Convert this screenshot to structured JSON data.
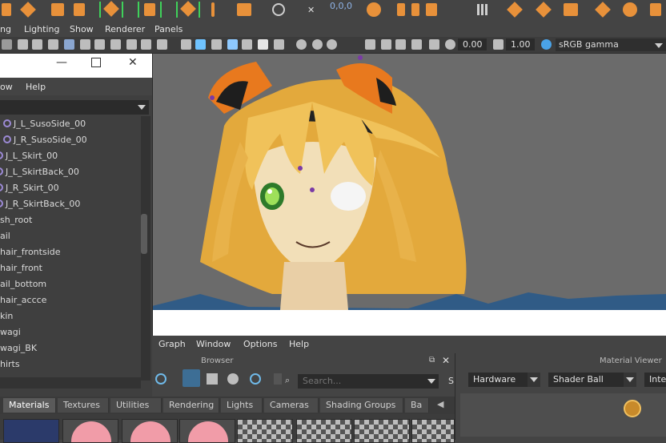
{
  "shelf": {
    "readout": "0,0,0",
    "icons": [
      "orange-shape-icon",
      "move-tool-icon",
      "scale-tool-icon",
      "rotate-tool-icon",
      "select-tool-icon",
      "snap-icon",
      "camera-icon"
    ]
  },
  "viewport_menu": {
    "items": [
      "ng",
      "Lighting",
      "Show",
      "Renderer",
      "Panels"
    ]
  },
  "viewport_toolbar": {
    "exposure": "0.00",
    "gamma": "1.00",
    "colorspace": "sRGB gamma"
  },
  "outliner": {
    "menu": [
      "ow",
      "Help"
    ],
    "items": [
      {
        "label": "J_L_SusoSide_00",
        "joint": true
      },
      {
        "label": "J_R_SusoSide_00",
        "joint": true
      },
      {
        "label": "J_L_Skirt_00",
        "joint": true
      },
      {
        "label": "J_L_SkirtBack_00",
        "joint": true
      },
      {
        "label": "J_R_Skirt_00",
        "joint": true
      },
      {
        "label": "J_R_SkirtBack_00",
        "joint": true
      },
      {
        "label": "sh_root",
        "joint": false
      },
      {
        "label": "ail",
        "joint": false
      },
      {
        "label": "hair_frontside",
        "joint": false
      },
      {
        "label": "hair_front",
        "joint": false
      },
      {
        "label": "ail_bottom",
        "joint": false
      },
      {
        "label": "hair_accce",
        "joint": false
      },
      {
        "label": "kin",
        "joint": false
      },
      {
        "label": "wagi",
        "joint": false
      },
      {
        "label": "wagi_BK",
        "joint": false
      },
      {
        "label": "hirts",
        "joint": false
      }
    ]
  },
  "hypershade": {
    "menu": [
      "Graph",
      "Window",
      "Options",
      "Help"
    ],
    "browser_label": "Browser",
    "search_placeholder": "Search...",
    "material_viewer_label": "Material Viewer",
    "renderer": "Hardware",
    "shader": "Shader Ball",
    "inter": "Inter",
    "tabs": [
      "Materials",
      "Textures",
      "Utilities",
      "Rendering",
      "Lights",
      "Cameras",
      "Shading Groups",
      "Ba"
    ],
    "active_tab": "Materials"
  },
  "colors": {
    "accent_orange": "#e8913a",
    "selection_green": "#3fd15a",
    "joint_purple": "#9c8ad6",
    "hair_blonde": "#f0c25a"
  }
}
